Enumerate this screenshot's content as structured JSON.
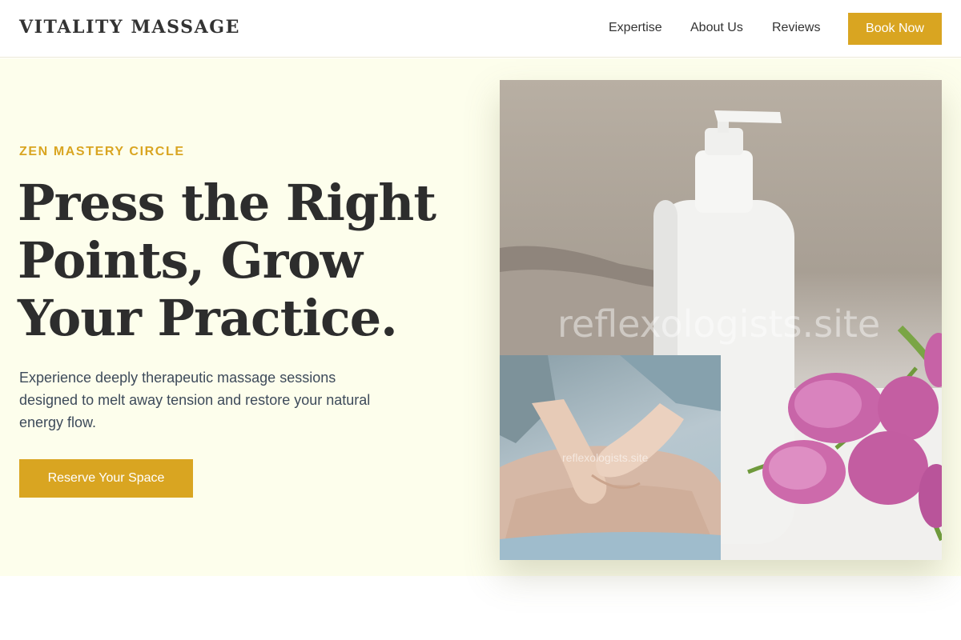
{
  "header": {
    "logo": "VITALITY MASSAGE",
    "nav": [
      "Expertise",
      "About Us",
      "Reviews"
    ],
    "book_label": "Book Now"
  },
  "hero": {
    "eyebrow": "ZEN MASTERY CIRCLE",
    "headline": "Press the Right Points, Grow Your Practice.",
    "subtext": "Experience deeply therapeutic massage sessions designed to melt away tension and restore your natural energy flow.",
    "cta_label": "Reserve Your Space"
  },
  "images": {
    "main_watermark": "reflexologists.site",
    "inset_watermark": "reflexologists.site"
  },
  "colors": {
    "accent": "#d9a521",
    "hero_bg": "#fdfeec",
    "text": "#2d2d2d"
  }
}
